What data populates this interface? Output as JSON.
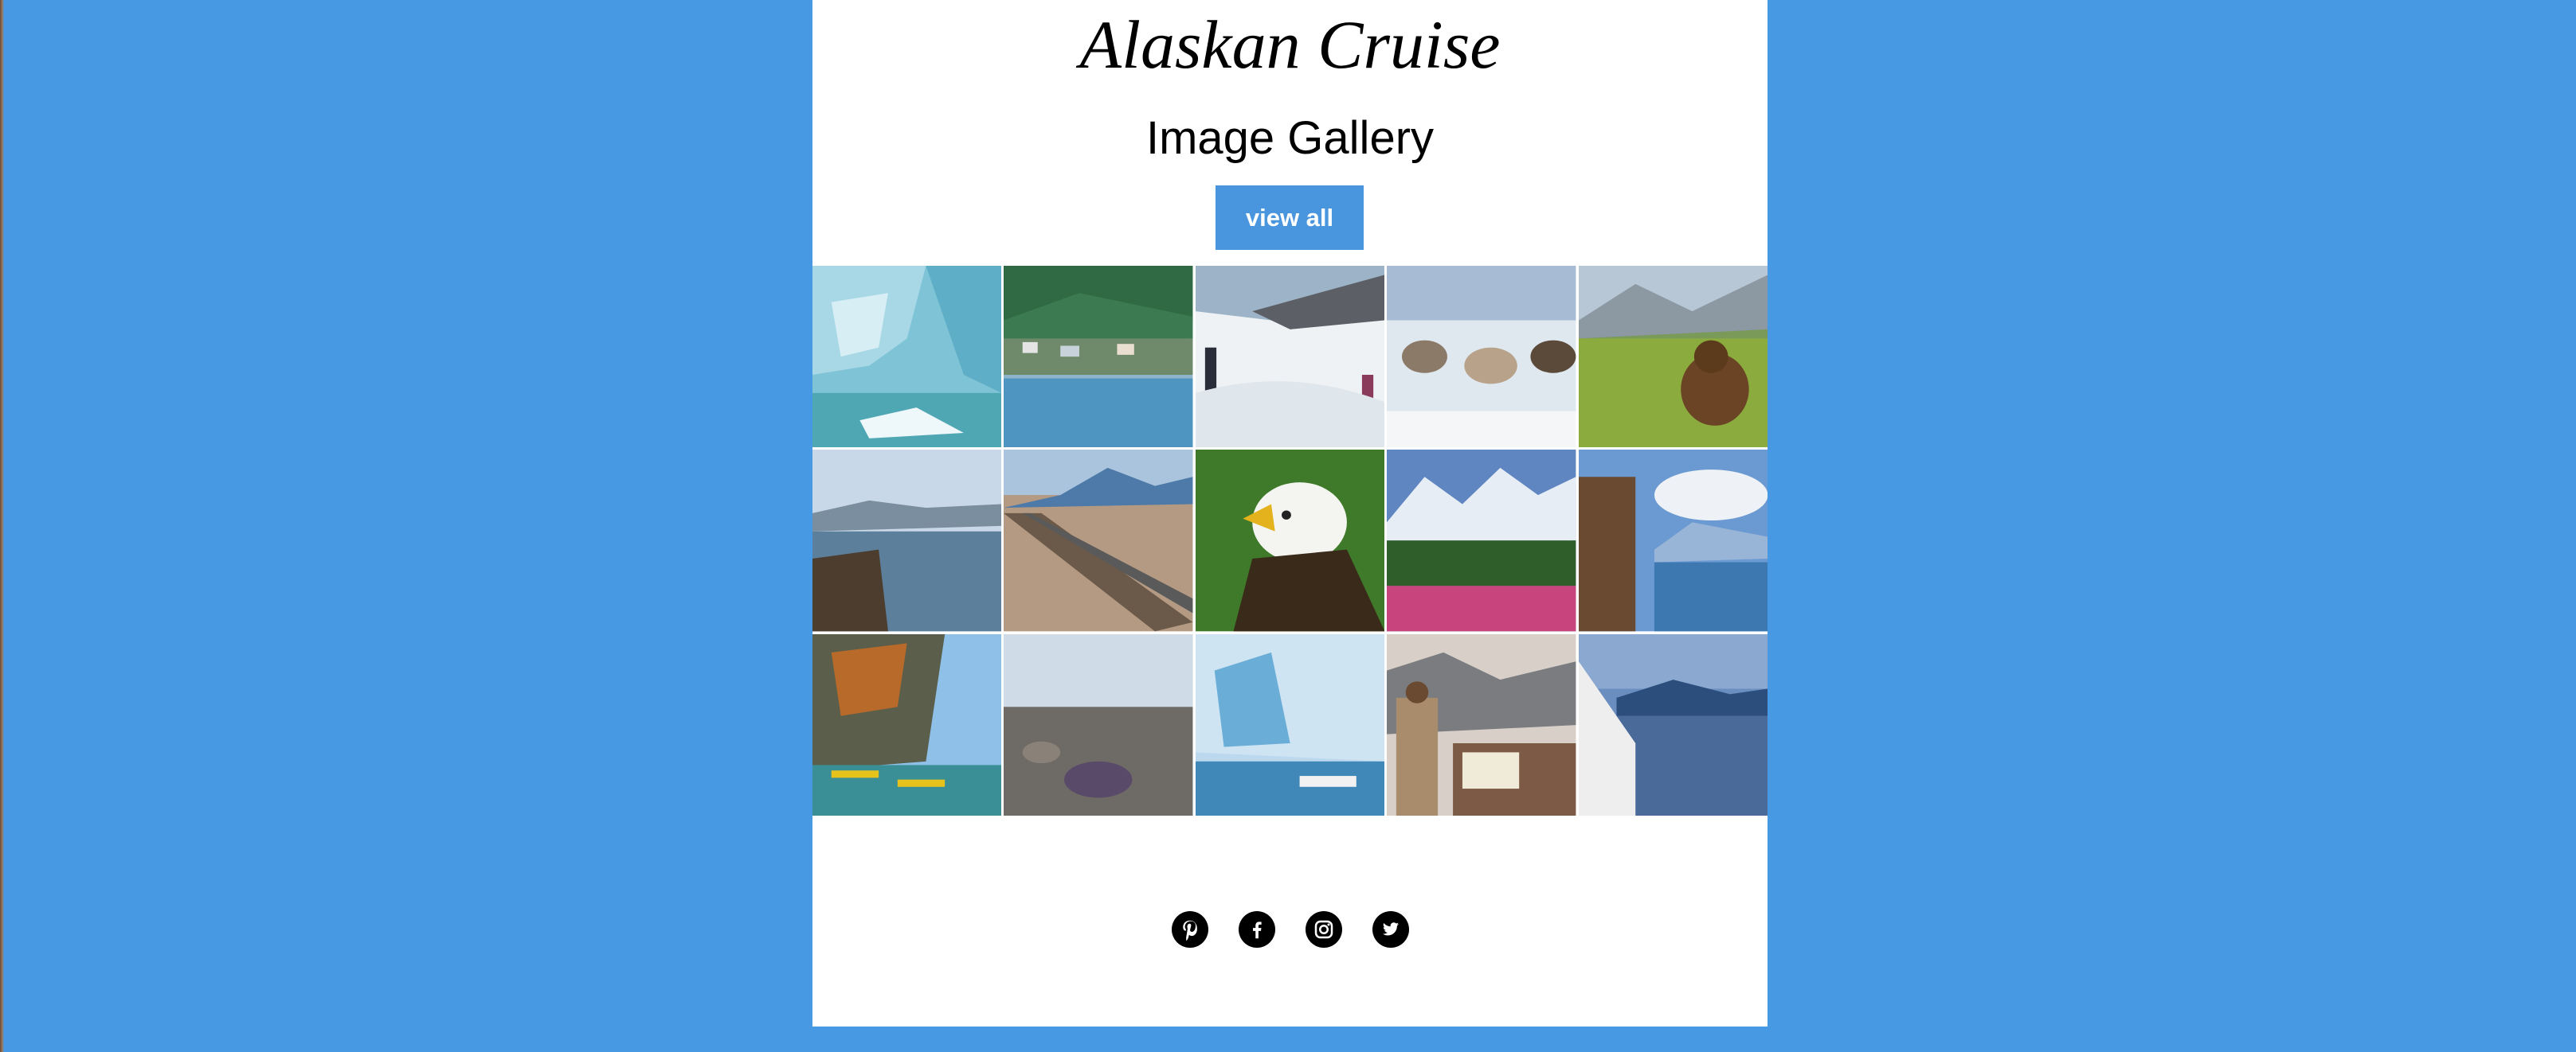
{
  "header": {
    "title": "Alaskan Cruise",
    "subtitle": "Image Gallery"
  },
  "gallery": {
    "button_label": "view all",
    "images": [
      "glacier-ice",
      "harbor-town",
      "snowfield-hikers",
      "sled-dogs",
      "brown-bear",
      "coastal-lake",
      "railroad-tracks",
      "bald-eagle",
      "mountain-glacier-meadow",
      "lodge-overlook",
      "kayakers",
      "rocky-shore",
      "glacier-boat",
      "woman-on-deck",
      "ship-bow-fjord"
    ]
  },
  "social": {
    "icons": [
      "pinterest-icon",
      "facebook-icon",
      "instagram-icon",
      "twitter-icon"
    ]
  },
  "colors": {
    "background": "#4699e2",
    "button": "#4a96de",
    "card": "#ffffff"
  }
}
